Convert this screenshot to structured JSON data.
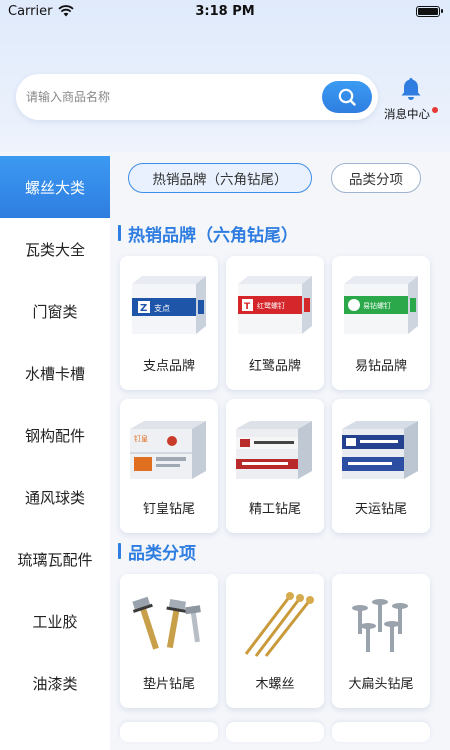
{
  "status": {
    "carrier": "Carrier",
    "time": "3:18 PM"
  },
  "search": {
    "placeholder": "请输入商品名称"
  },
  "message_center": {
    "label": "消息中心"
  },
  "sidebar": {
    "items": [
      {
        "label": "螺丝大类",
        "active": true
      },
      {
        "label": "瓦类大全"
      },
      {
        "label": "门窗类"
      },
      {
        "label": "水槽卡槽"
      },
      {
        "label": "钢构配件"
      },
      {
        "label": "通风球类"
      },
      {
        "label": "琉璃瓦配件"
      },
      {
        "label": "工业胶"
      },
      {
        "label": "油漆类"
      }
    ]
  },
  "tabs": [
    {
      "label": "热销品牌（六角钻尾）",
      "active": true
    },
    {
      "label": "品类分项"
    }
  ],
  "sections": [
    {
      "title": "热销品牌（六角钻尾）",
      "items": [
        {
          "label": "支点品牌",
          "icon": "blue-box"
        },
        {
          "label": "红鹭品牌",
          "icon": "red-box"
        },
        {
          "label": "易钻品牌",
          "icon": "green-box"
        },
        {
          "label": "钉皇钻尾",
          "icon": "stacked-boxes-orange"
        },
        {
          "label": "精工钻尾",
          "icon": "stacked-boxes-red"
        },
        {
          "label": "天运钻尾",
          "icon": "stacked-boxes-blue"
        }
      ]
    },
    {
      "title": "品类分项",
      "items": [
        {
          "label": "垫片钻尾",
          "icon": "washer-screws"
        },
        {
          "label": "木螺丝",
          "icon": "wood-screws"
        },
        {
          "label": "大扁头钻尾",
          "icon": "flat-head-screws"
        }
      ]
    }
  ],
  "brand_text": {
    "zhidian": "支点",
    "honglu": "红鹭螺钉",
    "yizuan": "易钻螺钉",
    "dinghuang": "钉皇"
  },
  "colors": {
    "accent": "#2f7de0",
    "notify": "#e53935"
  }
}
